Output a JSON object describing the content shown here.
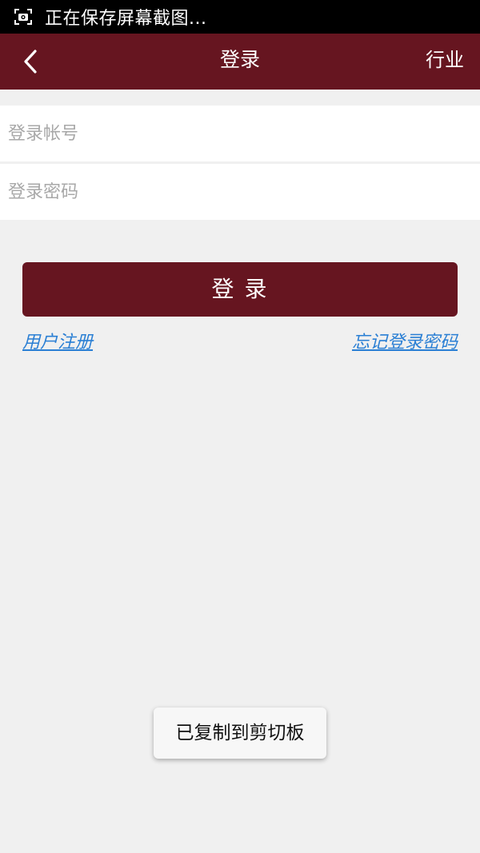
{
  "status_bar": {
    "icon": "screenshot-icon",
    "text": "正在保存屏幕截图..."
  },
  "header": {
    "back_icon": "chevron-left-icon",
    "title": "登录",
    "right_action": "行业"
  },
  "form": {
    "account_placeholder": "登录帐号",
    "account_value": "",
    "password_placeholder": "登录密码",
    "password_value": ""
  },
  "login_button": {
    "label": "登  录"
  },
  "links": {
    "register": "用户注册",
    "forgot_password": "忘记登录密码"
  },
  "toast": {
    "text": "已复制到剪切板"
  },
  "colors": {
    "brand": "#661520",
    "link": "#2a7fd4",
    "background": "#f0f0f0"
  }
}
